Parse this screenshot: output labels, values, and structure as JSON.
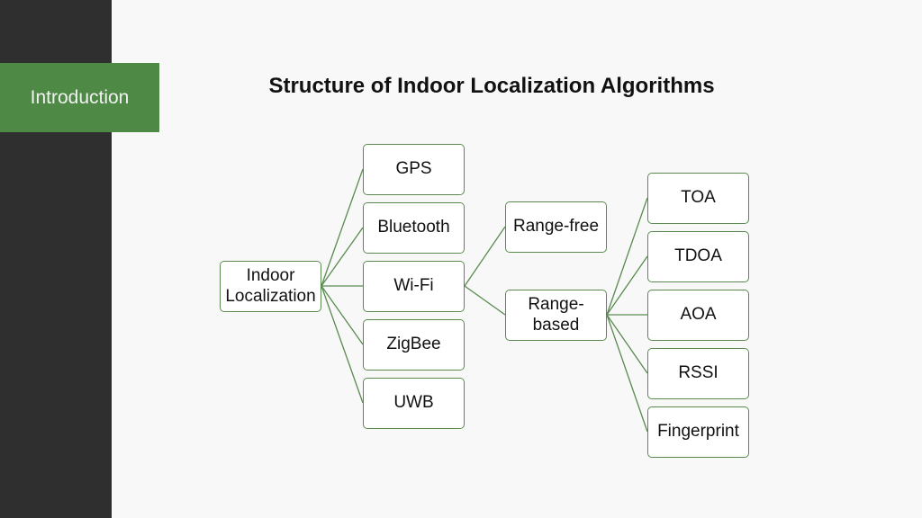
{
  "sidebar": {
    "section_label": "Introduction"
  },
  "slide": {
    "title": "Structure of Indoor Localization Algorithms"
  },
  "diagram": {
    "root": "Indoor Localization",
    "level1": [
      "GPS",
      "Bluetooth",
      "Wi-Fi",
      "ZigBee",
      "UWB"
    ],
    "level2": [
      "Range-free",
      "Range-based"
    ],
    "level3": [
      "TOA",
      "TDOA",
      "AOA",
      "RSSI",
      "Fingerprint"
    ],
    "accent_color": "#4e8a46",
    "line_color": "#5a8a50"
  }
}
